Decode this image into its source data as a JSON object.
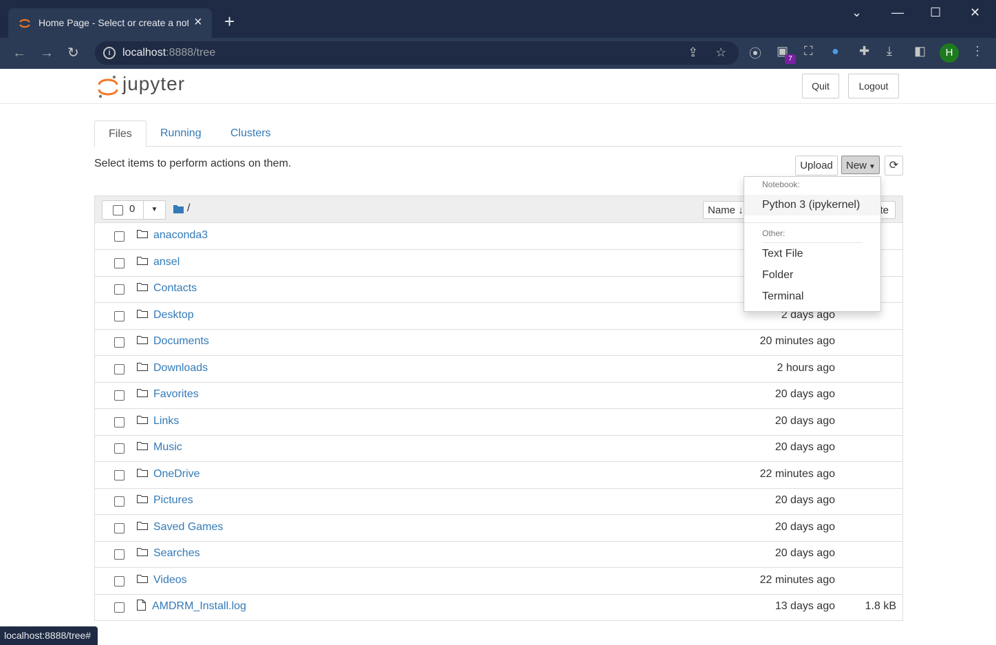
{
  "browser": {
    "tab_title": "Home Page - Select or create a notebook",
    "url_host": "localhost",
    "url_rest": ":8888/tree",
    "extension_badge": "7",
    "profile_initial": "H",
    "status_url": "localhost:8888/tree#"
  },
  "header": {
    "logo_text": "jupyter",
    "quit_label": "Quit",
    "logout_label": "Logout"
  },
  "tabs": [
    {
      "label": "Files"
    },
    {
      "label": "Running"
    },
    {
      "label": "Clusters"
    }
  ],
  "toolbar": {
    "hint": "Select items to perform actions on them.",
    "upload_label": "Upload",
    "new_label": "New",
    "selected_count": "0",
    "path": "/",
    "sort_name_label": "Name",
    "sort_modified_label": "te"
  },
  "new_menu": {
    "notebook_header": "Notebook:",
    "python_kernel": "Python 3 (ipykernel)",
    "other_header": "Other:",
    "text_file": "Text File",
    "folder": "Folder",
    "terminal": "Terminal"
  },
  "items": [
    {
      "name": "anaconda3",
      "time": "",
      "size": "",
      "type": "folder"
    },
    {
      "name": "ansel",
      "time": "",
      "size": "",
      "type": "folder"
    },
    {
      "name": "Contacts",
      "time": "",
      "size": "",
      "type": "folder"
    },
    {
      "name": "Desktop",
      "time": "2 days ago",
      "size": "",
      "type": "folder"
    },
    {
      "name": "Documents",
      "time": "20 minutes ago",
      "size": "",
      "type": "folder"
    },
    {
      "name": "Downloads",
      "time": "2 hours ago",
      "size": "",
      "type": "folder"
    },
    {
      "name": "Favorites",
      "time": "20 days ago",
      "size": "",
      "type": "folder"
    },
    {
      "name": "Links",
      "time": "20 days ago",
      "size": "",
      "type": "folder"
    },
    {
      "name": "Music",
      "time": "20 days ago",
      "size": "",
      "type": "folder"
    },
    {
      "name": "OneDrive",
      "time": "22 minutes ago",
      "size": "",
      "type": "folder"
    },
    {
      "name": "Pictures",
      "time": "20 days ago",
      "size": "",
      "type": "folder"
    },
    {
      "name": "Saved Games",
      "time": "20 days ago",
      "size": "",
      "type": "folder"
    },
    {
      "name": "Searches",
      "time": "20 days ago",
      "size": "",
      "type": "folder"
    },
    {
      "name": "Videos",
      "time": "22 minutes ago",
      "size": "",
      "type": "folder"
    },
    {
      "name": "AMDRM_Install.log",
      "time": "13 days ago",
      "size": "1.8 kB",
      "type": "file"
    }
  ],
  "colors": {
    "link": "#337ab7",
    "chrome_dark": "#1f2a44",
    "jupyter_orange": "#f37726"
  }
}
